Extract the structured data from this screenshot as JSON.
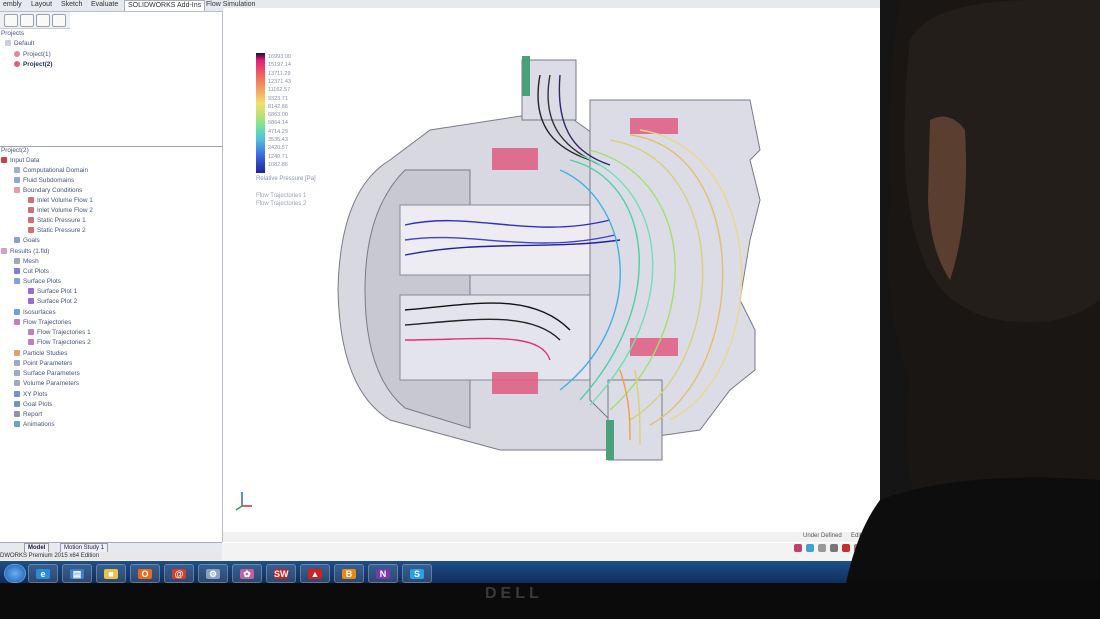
{
  "ribbon": {
    "tabs": [
      "embly",
      "Layout",
      "Sketch",
      "Evaluate",
      "SOLIDWORKS Add-Ins",
      "Flow Simulation"
    ],
    "selected": 4,
    "view_toolbar_icons": [
      "search-icon",
      "zoom-icon",
      "rotate-icon",
      "view-orientation-icon",
      "display-style-icon",
      "section-icon",
      "appearance-icon",
      "scene-icon",
      "render-icon",
      "monitor-icon"
    ]
  },
  "project_tree": {
    "title": "Projects",
    "items": [
      "Default",
      "Project(1)",
      "Project(2)"
    ]
  },
  "analysis_tree": {
    "title": "Project(2)",
    "items": [
      "Input Data",
      "Computational Domain",
      "Fluid Subdomains",
      "Boundary Conditions",
      "Inlet Volume Flow 1",
      "Inlet Volume Flow 2",
      "Static Pressure 1",
      "Static Pressure 2",
      "Goals",
      "Results (1.fld)",
      "Mesh",
      "Cut Plots",
      "Surface Plots",
      "Surface Plot 1",
      "Surface Plot 2",
      "Isosurfaces",
      "Flow Trajectories",
      "Flow Trajectories 1",
      "Flow Trajectories 2",
      "Particle Studies",
      "Point Parameters",
      "Surface Parameters",
      "Volume Parameters",
      "XY Plots",
      "Goal Plots",
      "Report",
      "Animations"
    ]
  },
  "bottom_tabs": [
    "Model",
    "Motion Study 1"
  ],
  "status_left": "DWORKS Premium 2015 x64 Edition",
  "legend": {
    "values": [
      "16993.00",
      "15197.14",
      "13711.29",
      "12371.43",
      "11162.57",
      "9323.71",
      "8142.86",
      "6863.00",
      "5864.14",
      "4714.29",
      "3535.43",
      "2420.57",
      "1240.71",
      "1082.86"
    ],
    "caption": "Relative Pressure [Pa]",
    "trajectories": [
      "Flow Trajectories 1",
      "Flow Trajectories 2"
    ]
  },
  "status_bar": {
    "text": "Under Defined",
    "edit": "Editing"
  },
  "taskbar": {
    "start_label": "Start",
    "apps": [
      {
        "name": "ie",
        "glyph": "e",
        "color": "#2a8ae0"
      },
      {
        "name": "explorer",
        "glyph": "▤",
        "color": "#3f7fcf"
      },
      {
        "name": "folder",
        "glyph": "■",
        "color": "#e8c04a"
      },
      {
        "name": "outlook",
        "glyph": "O",
        "color": "#e86a1c"
      },
      {
        "name": "app-swirl",
        "glyph": "@",
        "color": "#d0402a"
      },
      {
        "name": "settings",
        "glyph": "⚙",
        "color": "#8aa0c0"
      },
      {
        "name": "paint",
        "glyph": "✿",
        "color": "#c060a0"
      },
      {
        "name": "solidworks",
        "glyph": "SW",
        "color": "#c82027"
      },
      {
        "name": "pdf",
        "glyph": "▲",
        "color": "#d02020"
      },
      {
        "name": "app-b",
        "glyph": "B",
        "color": "#e88a1a"
      },
      {
        "name": "onenote",
        "glyph": "N",
        "color": "#7a3aa8"
      },
      {
        "name": "skype",
        "glyph": "S",
        "color": "#2aa0e8"
      }
    ]
  },
  "brand": "DELL",
  "colors": {
    "accent": "#e0207a",
    "taskbar": "#1e4f8a"
  }
}
